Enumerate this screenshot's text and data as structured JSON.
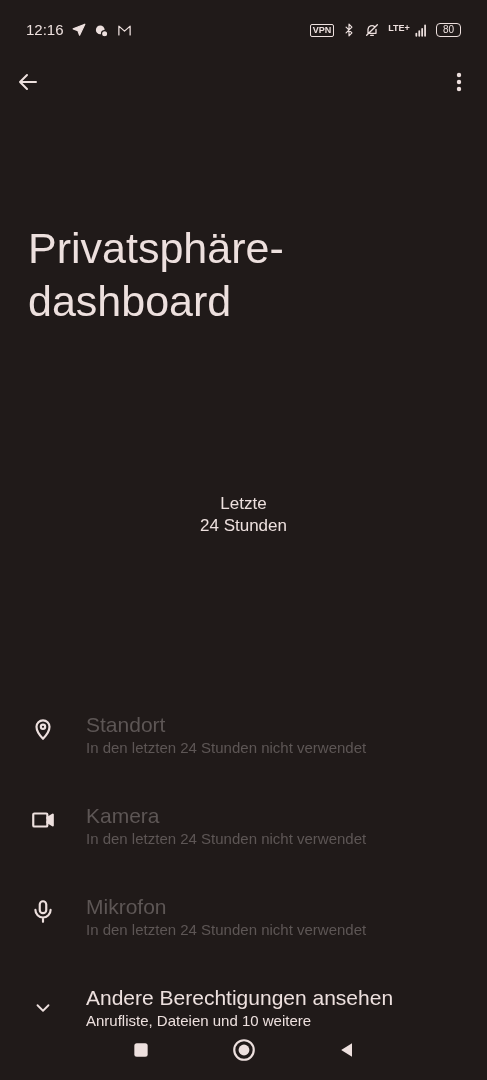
{
  "status_bar": {
    "time": "12:16",
    "vpn": "VPN",
    "network": "LTE+",
    "battery": "80"
  },
  "title": "Privatsphäre-dashboard",
  "period": {
    "line_1": "Letzte",
    "line_2": "24 Stunden"
  },
  "permissions": [
    {
      "kind": "location",
      "name": "Standort",
      "detail": "In den letzten 24 Stunden nicht verwendet",
      "used": false
    },
    {
      "kind": "camera",
      "name": "Kamera",
      "detail": "In den letzten 24 Stunden nicht verwendet",
      "used": false
    },
    {
      "kind": "microphone",
      "name": "Mikrofon",
      "detail": "In den letzten 24 Stunden nicht verwendet",
      "used": false
    }
  ],
  "more": {
    "title": "Andere Berechtigungen ansehen",
    "detail": "Anrufliste, Dateien und 10 weitere",
    "expanded": false
  }
}
